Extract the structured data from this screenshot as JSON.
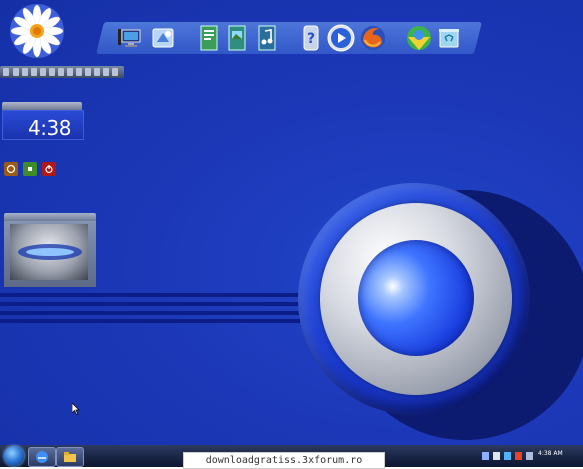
{
  "clock_gadget": {
    "time": "4:38"
  },
  "taskbar": {
    "clock": "4:38 AM"
  },
  "watermark": "downloadgratiss.3xforum.ro",
  "colors": {
    "desktop": "#1c38b8",
    "stripe": "#0b1d86",
    "taskbar": "#1a2646",
    "orb_core": "#2a5af0",
    "orb_ring": "#c9ccd6"
  },
  "dock": {
    "icons": [
      "computer-icon",
      "control-panel-icon",
      "documents-icon",
      "pictures-icon",
      "music-icon",
      "help-icon",
      "media-player-icon",
      "firefox-icon",
      "internet-explorer-icon",
      "recycle-bin-icon"
    ]
  }
}
